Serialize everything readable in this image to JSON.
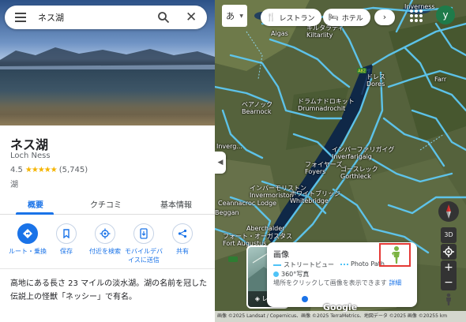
{
  "search": {
    "query": "ネス湖"
  },
  "place": {
    "name": "ネス湖",
    "subtitle": "Loch Ness",
    "rating": "4.5",
    "stars": "★★★★★",
    "review_count": "(5,745)",
    "category": "湖"
  },
  "tabs": [
    {
      "label": "概要"
    },
    {
      "label": "クチコミ"
    },
    {
      "label": "基本情報"
    }
  ],
  "actions": [
    {
      "label": "ルート・乗換",
      "icon": "directions-icon"
    },
    {
      "label": "保存",
      "icon": "bookmark-icon"
    },
    {
      "label": "付近を検索",
      "icon": "nearby-icon"
    },
    {
      "label": "モバイルデバイスに送信",
      "icon": "send-to-phone-icon"
    },
    {
      "label": "共有",
      "icon": "share-icon"
    }
  ],
  "description": "高地にある長さ 23 マイルの淡水湖。湖の名前を冠した伝説上の怪獣「ネッシー」で有名。",
  "map": {
    "ime_label": "あ",
    "chips": [
      {
        "label": "レストラン",
        "icon": "restaurant-icon"
      },
      {
        "label": "ホテル",
        "icon": "hotel-icon"
      }
    ],
    "profile_initial": "y",
    "places": [
      {
        "label": "Inverness"
      },
      {
        "label": "Aigas"
      },
      {
        "label": "キルタラティ\nKiltarlity"
      },
      {
        "label": "ドレス\nDores"
      },
      {
        "label": "Farr"
      },
      {
        "label": "ベアノック\nBearnock"
      },
      {
        "label": "ドラムナドロキット\nDrumnadrochit"
      },
      {
        "label": "インバーファリガイグ\nInverfarigaig"
      },
      {
        "label": "フォイヤーズ\nFoyers"
      },
      {
        "label": "ゴースレック\nGorthleck"
      },
      {
        "label": "インバーモリストン\nInvermoriston"
      },
      {
        "label": "ホワイトブリッジ\nWhitebridge"
      },
      {
        "label": "Aberchalder"
      },
      {
        "label": "Ceannacroc Lodge"
      },
      {
        "label": "フォート・オーガスタス\nFort Augustus"
      },
      {
        "label": "Inverg..."
      },
      {
        "label": "Beggan"
      }
    ],
    "road_label": "A82",
    "layer_label": "レイヤ",
    "view_3d": "3D",
    "google_text": "Google",
    "attribution": "画像 ©2025 Landsat / Copernicus、画像 ©2025 TerraMetrics、地図データ ©2025 画像 ©20255 km",
    "imagery_panel": {
      "title": "画像",
      "legend_street": "ストリートビュー",
      "legend_photo": "Photo Path",
      "legend_360": "360°写真",
      "hint": "場所をクリックして画像を表示できます",
      "more_link": "詳細"
    }
  }
}
